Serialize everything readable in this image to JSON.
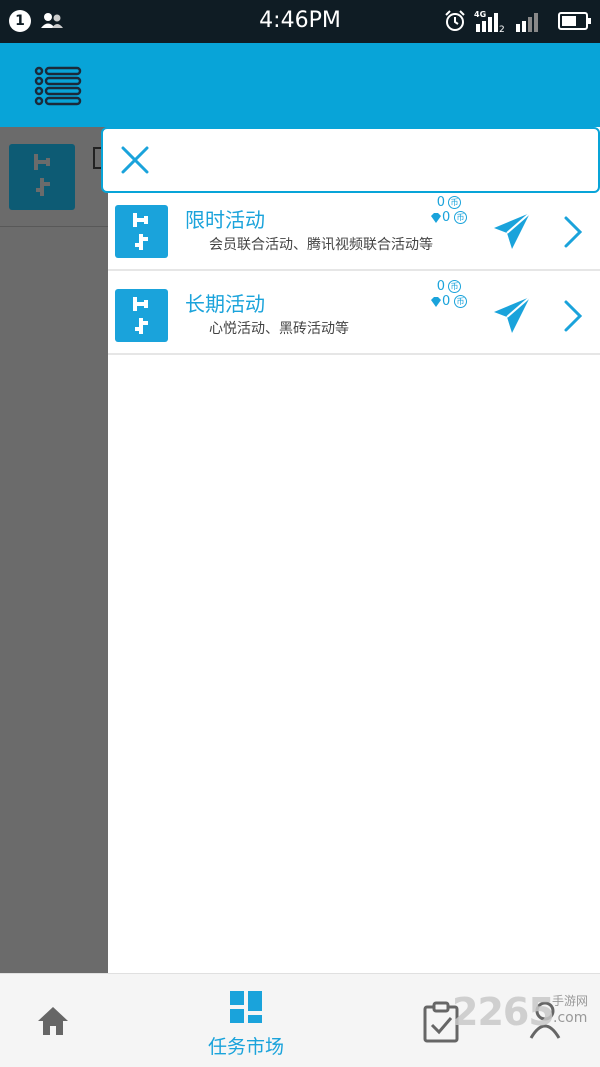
{
  "status_bar": {
    "notification_count": "1",
    "time": "4:46PM",
    "network_type": "4G",
    "sim_index": "2",
    "icons": [
      "users-icon",
      "alarm-icon",
      "signal-icon",
      "battery-icon"
    ]
  },
  "header": {
    "menu_icon": "list-menu-icon",
    "background_color": "#08a4d8"
  },
  "drawer": {
    "search_value": "",
    "close_icon": "close-icon",
    "items": [
      {
        "title": "限时活动",
        "description": "会员联合活动、腾讯视频联合活动等",
        "coin_count": "0",
        "vip_coin_count": "0",
        "coin_symbol": "币"
      },
      {
        "title": "长期活动",
        "description": "心悦活动、黑砖活动等",
        "coin_count": "0",
        "vip_coin_count": "0",
        "coin_symbol": "币"
      }
    ]
  },
  "bottom_nav": {
    "items": [
      {
        "name": "home",
        "icon": "home-icon",
        "label": ""
      },
      {
        "name": "market",
        "icon": "market-icon",
        "label": "任务市场",
        "active": true
      },
      {
        "name": "tasks",
        "icon": "clipboard-check-icon",
        "label": ""
      },
      {
        "name": "profile",
        "icon": "user-icon",
        "label": ""
      }
    ],
    "watermark": {
      "text": "2265",
      "sub": "手游网",
      "domain": ".com"
    }
  },
  "colors": {
    "accent": "#1aa3db",
    "status_bar": "#0f1c24",
    "overlay": "#6b6b6b"
  }
}
